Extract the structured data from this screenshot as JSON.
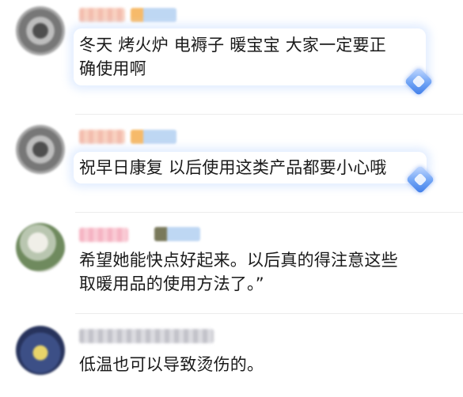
{
  "comments": [
    {
      "text_line1": "冬天 烤火炉 电褥子 暖宝宝 大家一定要正",
      "text_line2": "确使用啊"
    },
    {
      "text_line1": "祝早日康复 以后使用这类产品都要小心哦"
    },
    {
      "text_line1": "希望她能快点好起来。以后真的得注意这些",
      "text_line2": "取暖用品的使用方法了。”"
    },
    {
      "text_line1": "低温也可以导致烫伤的。"
    }
  ],
  "colors": {
    "accent_diamond": "#6fa3f5",
    "bubble_glow": "#d7e6ff",
    "divider": "#ececec"
  },
  "icons": [
    "avatar",
    "member-badge-icon",
    "diamond-icon"
  ]
}
